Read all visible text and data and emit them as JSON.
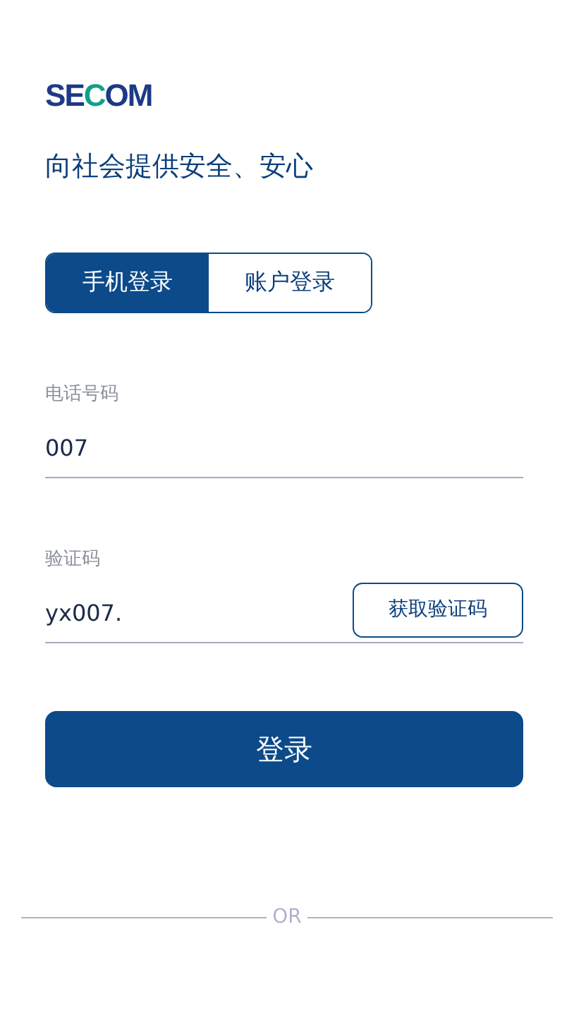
{
  "logo": {
    "text": "SECOM"
  },
  "tagline": "向社会提供安全、安心",
  "tabs": [
    {
      "label": "手机登录",
      "selected": true
    },
    {
      "label": "账户登录",
      "selected": false
    }
  ],
  "phone": {
    "label": "电话号码",
    "value": "007"
  },
  "code": {
    "label": "验证码",
    "value": "yx007.",
    "button": "获取验证码"
  },
  "login_button": "登录",
  "divider": "OR"
}
